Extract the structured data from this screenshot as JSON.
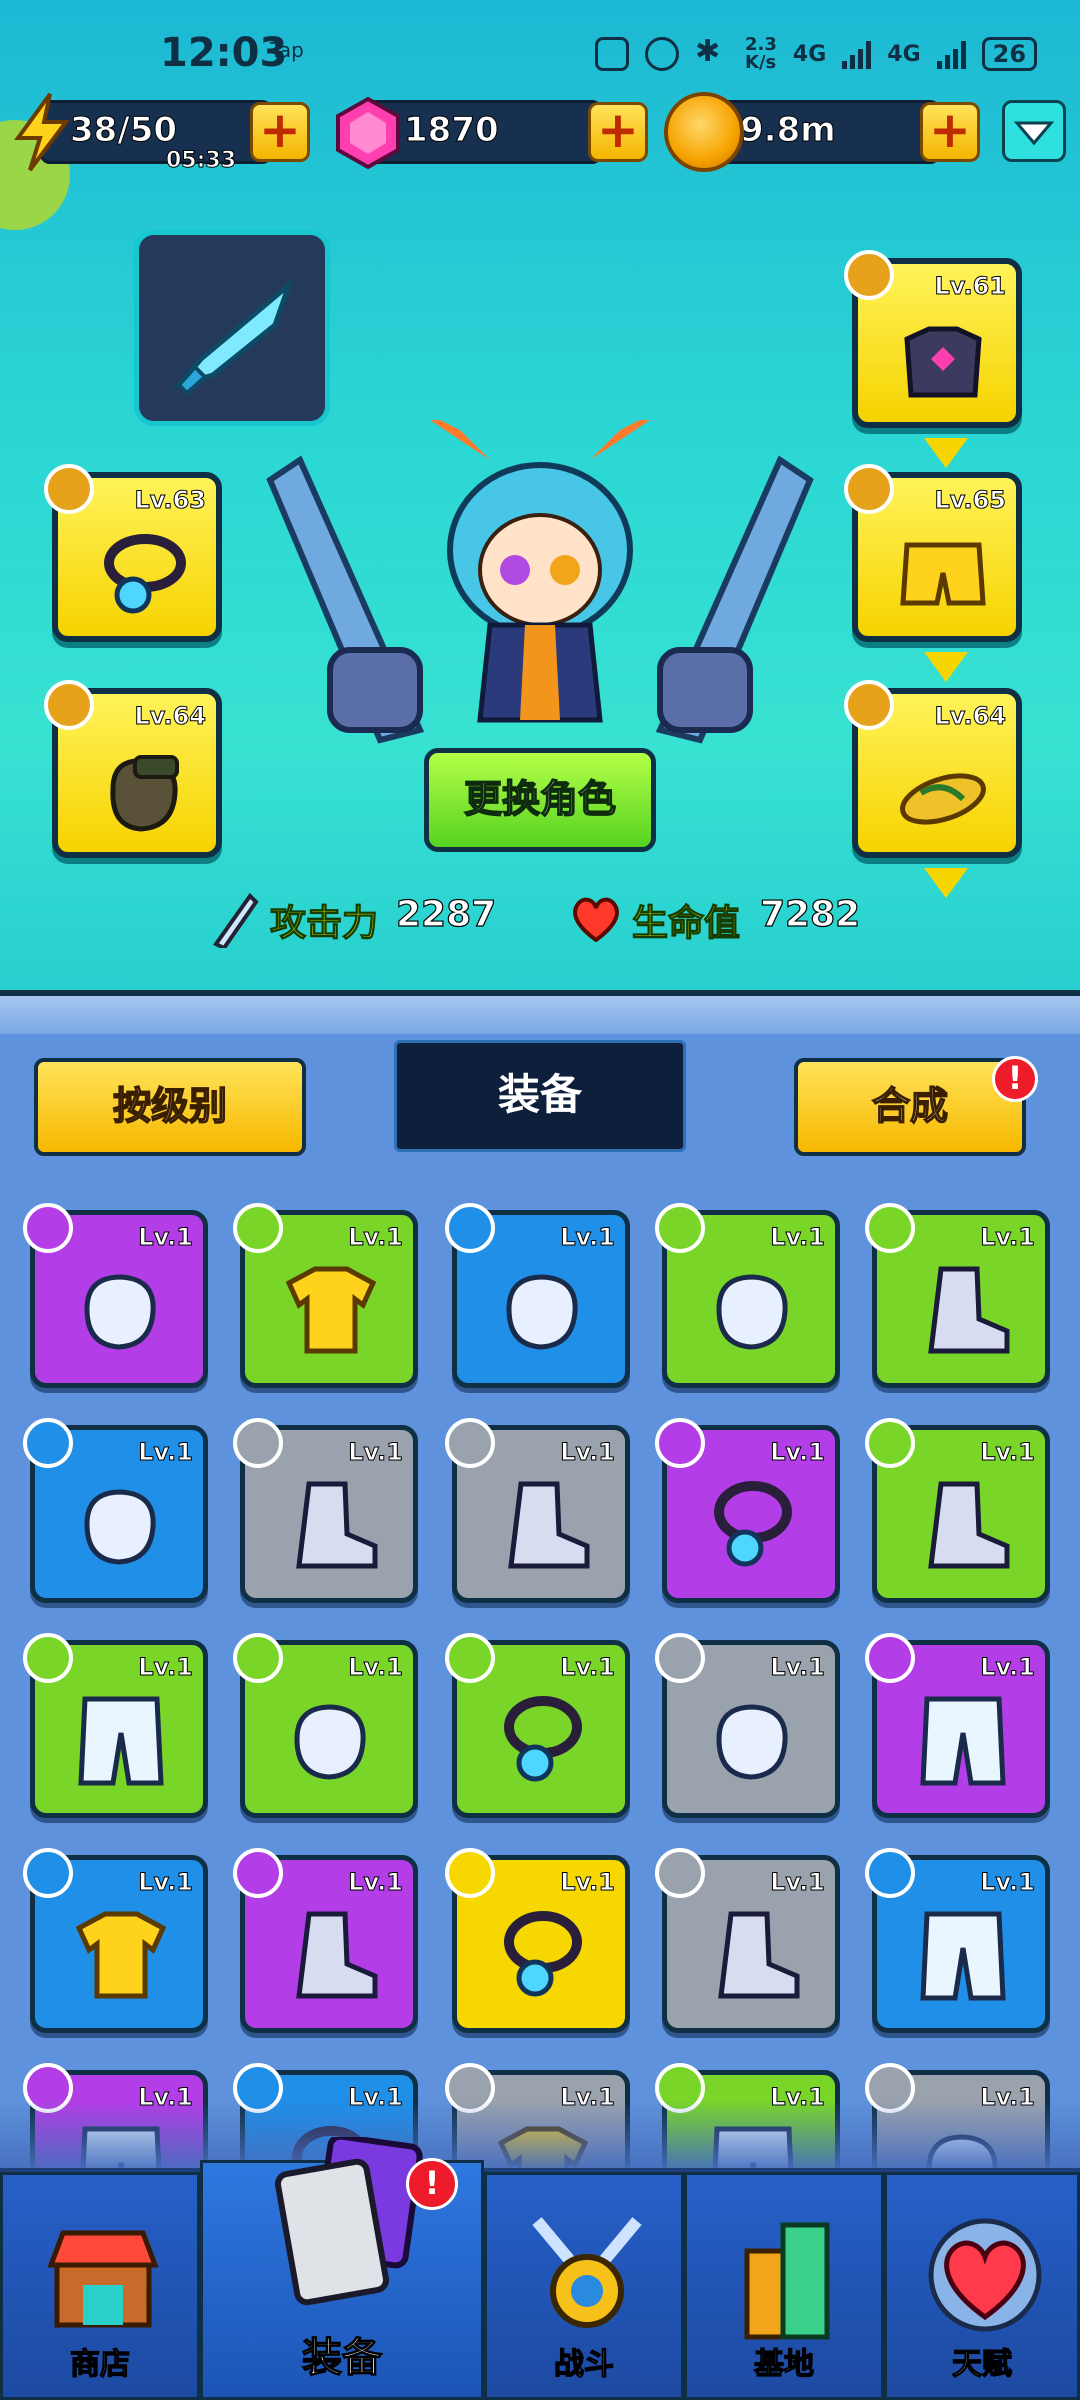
{
  "status_bar": {
    "time": "12:03",
    "tap_label": "Tap",
    "speed": "2.3\nK/s",
    "network_1": "4G",
    "network_2": "4G",
    "battery": "26"
  },
  "resources": {
    "energy": {
      "value": "38/50",
      "timer": "05:33"
    },
    "gems": {
      "value": "1870"
    },
    "coins": {
      "value": "9.8m"
    },
    "plus_label": "+"
  },
  "equipped": {
    "chest": {
      "level": "Lv.61"
    },
    "necklace": {
      "level": "Lv.63"
    },
    "pants": {
      "level": "Lv.65"
    },
    "gloves": {
      "level": "Lv.64"
    },
    "shoes": {
      "level": "Lv.64"
    }
  },
  "hero": {
    "change_character": "更换角色",
    "attack_label": "攻击力",
    "attack_value": "2287",
    "hp_label": "生命值",
    "hp_value": "7282"
  },
  "panel": {
    "sort_button": "按级别",
    "title": "装备",
    "merge_button": "合成",
    "merge_alert": "!"
  },
  "inventory": [
    {
      "level": "Lv.1",
      "bg": "purple",
      "item": "gloves-icon"
    },
    {
      "level": "Lv.1",
      "bg": "green",
      "item": "shirt-icon"
    },
    {
      "level": "Lv.1",
      "bg": "blue",
      "item": "gloves-icon"
    },
    {
      "level": "Lv.1",
      "bg": "green",
      "item": "gloves-icon"
    },
    {
      "level": "Lv.1",
      "bg": "green",
      "item": "shoes-icon"
    },
    {
      "level": "Lv.1",
      "bg": "blue",
      "item": "gloves-icon"
    },
    {
      "level": "Lv.1",
      "bg": "gray",
      "item": "shoes-icon"
    },
    {
      "level": "Lv.1",
      "bg": "gray",
      "item": "shoes-icon"
    },
    {
      "level": "Lv.1",
      "bg": "purple",
      "item": "necklace-icon"
    },
    {
      "level": "Lv.1",
      "bg": "green",
      "item": "shoes-icon"
    },
    {
      "level": "Lv.1",
      "bg": "green",
      "item": "pants-icon"
    },
    {
      "level": "Lv.1",
      "bg": "green",
      "item": "gloves-icon"
    },
    {
      "level": "Lv.1",
      "bg": "green",
      "item": "necklace-icon"
    },
    {
      "level": "Lv.1",
      "bg": "gray",
      "item": "gloves-icon"
    },
    {
      "level": "Lv.1",
      "bg": "purple",
      "item": "pants-icon"
    },
    {
      "level": "Lv.1",
      "bg": "blue",
      "item": "shirt-icon"
    },
    {
      "level": "Lv.1",
      "bg": "purple",
      "item": "shoes-icon"
    },
    {
      "level": "Lv.1",
      "bg": "yellow",
      "item": "necklace-icon"
    },
    {
      "level": "Lv.1",
      "bg": "gray",
      "item": "shoes-icon"
    },
    {
      "level": "Lv.1",
      "bg": "blue",
      "item": "pants-icon"
    },
    {
      "level": "Lv.1",
      "bg": "purple",
      "item": "pants-icon"
    },
    {
      "level": "Lv.1",
      "bg": "blue",
      "item": "necklace-icon"
    },
    {
      "level": "Lv.1",
      "bg": "gray",
      "item": "shirt-icon"
    },
    {
      "level": "Lv.1",
      "bg": "green",
      "item": "pants-icon"
    },
    {
      "level": "Lv.1",
      "bg": "gray",
      "item": "gloves-icon"
    }
  ],
  "bg_colors": {
    "purple": "#b33de6",
    "green": "#79d628",
    "blue": "#1f8fe8",
    "gray": "#9aa3ad",
    "yellow": "#f6d800"
  },
  "bottom_nav": {
    "shop": "商店",
    "equipment": "装备",
    "battle": "战斗",
    "base": "基地",
    "talent": "天赋",
    "equipment_alert": "!"
  }
}
